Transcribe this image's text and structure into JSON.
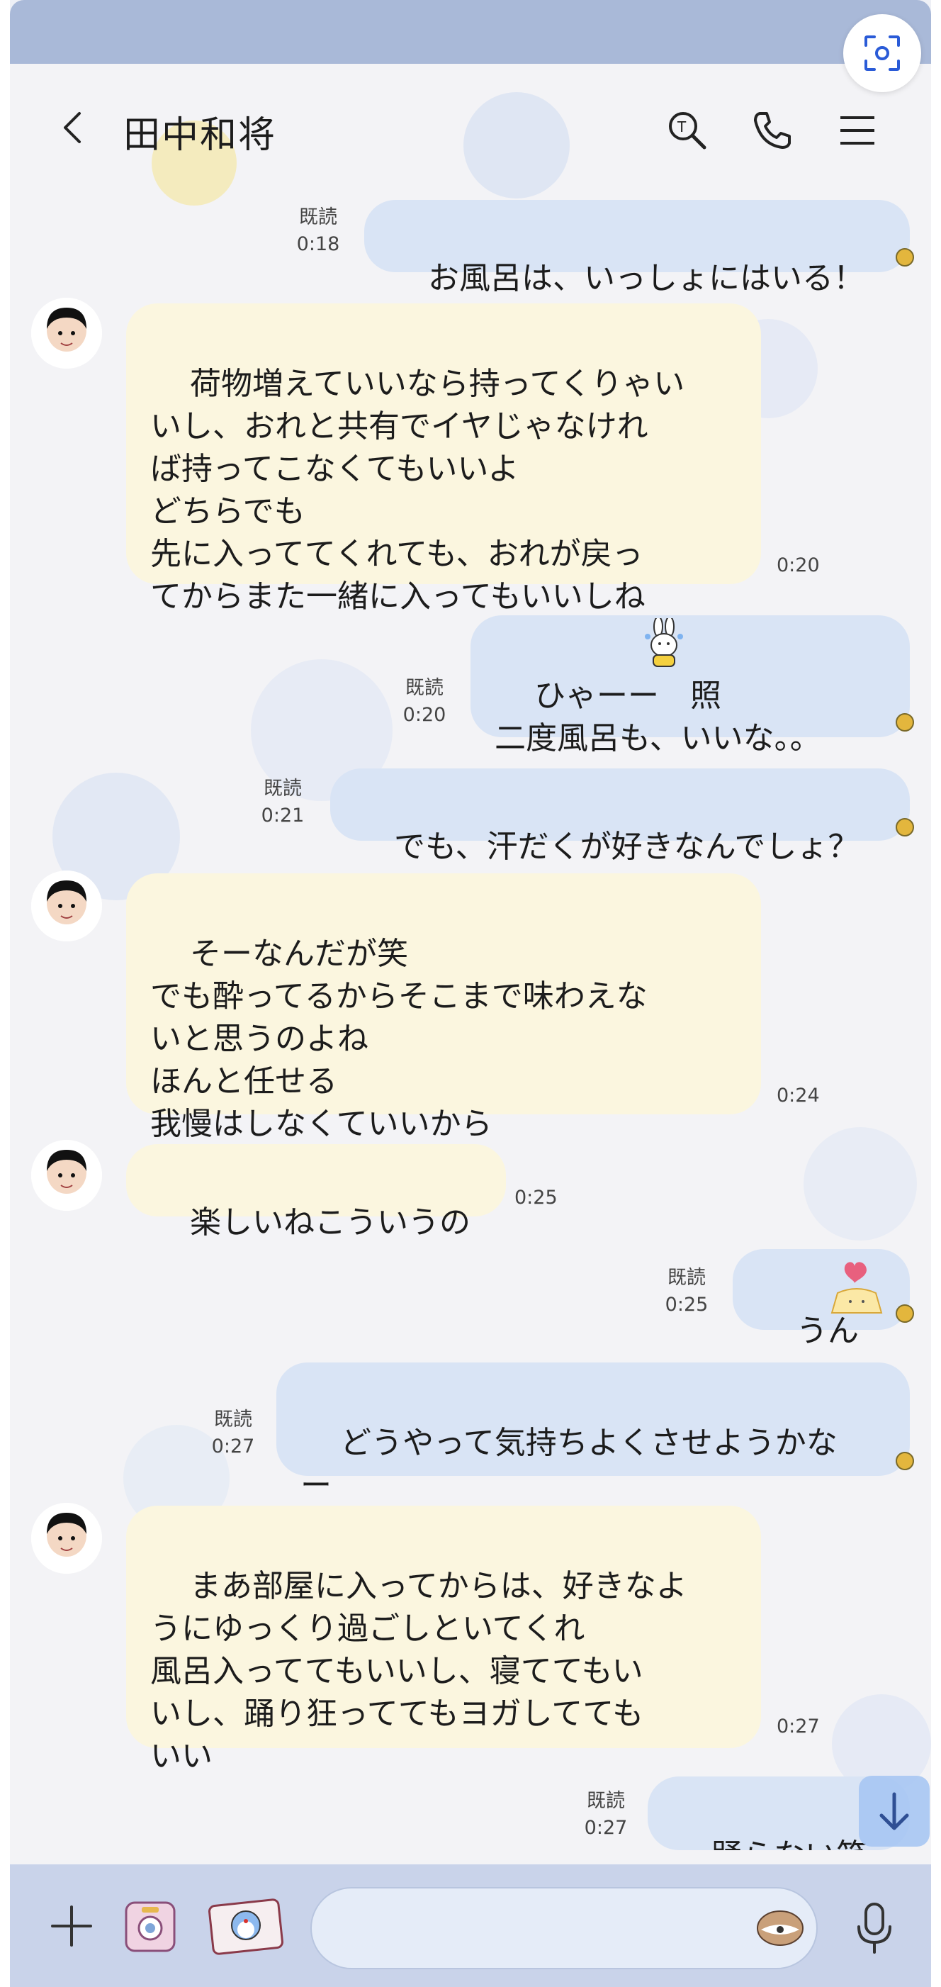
{
  "header": {
    "title": "田中和将",
    "icons": [
      "back-arrow-icon",
      "search-icon",
      "phone-icon",
      "menu-icon",
      "scan-icon"
    ]
  },
  "read_label": "既読",
  "messages": [
    {
      "side": "out",
      "text": "お風呂は、いっしょにはいる！",
      "read": "既読",
      "time": "0:18"
    },
    {
      "side": "in",
      "text": "荷物増えていいなら持ってくりゃい\nいし、おれと共有でイヤじゃなけれ\nば持ってこなくてもいいよ\nどちらでも\n先に入っててくれても、おれが戻っ\nてからまた一緒に入ってもいいしね",
      "time": "0:20"
    },
    {
      "side": "out",
      "text": "ひゃーー　照\n二度風呂も、いいな。。",
      "read": "既読",
      "time": "0:20",
      "emoji": "bunny-emoji"
    },
    {
      "side": "out",
      "text": "でも、汗だくが好きなんでしょ？",
      "read": "既読",
      "time": "0:21"
    },
    {
      "side": "in",
      "text": "そーなんだが笑\nでも酔ってるからそこまで味わえな\nいと思うのよね\nほんと任せる\n我慢はしなくていいから",
      "time": "0:24"
    },
    {
      "side": "in",
      "text": "楽しいねこういうの",
      "time": "0:25"
    },
    {
      "side": "out",
      "text": "うん",
      "read": "既読",
      "time": "0:25",
      "emoji": "heart-cat-emoji"
    },
    {
      "side": "out",
      "text": "どうやって気持ちよくさせようかな\nー",
      "read": "既読",
      "time": "0:27"
    },
    {
      "side": "in",
      "text": "まあ部屋に入ってからは、好きなよ\nうにゆっくり過ごしといてくれ\n風呂入っててもいいし、寝ててもい\nいし、踊り狂っててもヨガしてても\nいい",
      "time": "0:27"
    },
    {
      "side": "out",
      "text": "踊らない笑笑",
      "read": "既読",
      "time": "0:27"
    }
  ],
  "input": {
    "placeholder": ""
  },
  "colors": {
    "incoming_bubble": "#fbf6df",
    "outgoing_bubble": "#d9e4f5",
    "status_bar": "#a9b9d8",
    "input_bar": "#c9d3ea"
  }
}
